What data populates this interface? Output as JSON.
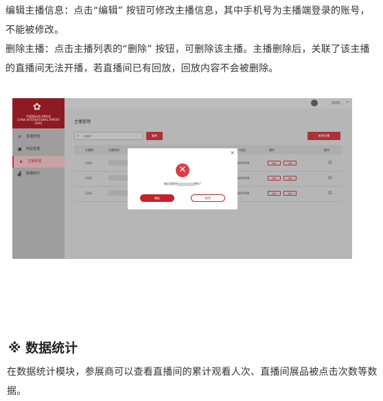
{
  "paragraphs": {
    "edit": "编辑主播信息：点击“编辑” 按钮可修改主播信息，其中手机号为主播端登录的账号，不能被修改。",
    "delete": "删除主播：点击主播列表的“删除” 按钮，可删除该主播。主播删除后，关联了该主播的直播间无法开播，若直播间已有回放，回放内容不会被删除。",
    "stats": "在数据统计模块，参展商可以查看直播间的累计观看人次、直播间展品被点击次数等数据。"
  },
  "section_title": "※ 数据统计",
  "screenshot": {
    "logo_text": "中国国际进口博览会",
    "logo_subtext": "CHINA INTERNATIONAL IMPORT EXPO",
    "sidebar": [
      {
        "label": "直播管理",
        "icon": "gear-icon",
        "active": false
      },
      {
        "label": "商品管理",
        "icon": "box-icon",
        "active": false
      },
      {
        "label": "主播管理",
        "icon": "person-icon",
        "active": true
      },
      {
        "label": "数据统计",
        "icon": "bar-chart-icon",
        "active": false
      }
    ],
    "user_name": "测试账...",
    "page_title": "主播管理",
    "search_placeholder": "主播ID",
    "search_button": "查询",
    "add_button": "新增主播",
    "columns": [
      "主播ID",
      "主播名称",
      "联系人电话",
      "操作",
      "操作"
    ],
    "rows": [
      {
        "id": "2345",
        "phone": "1324487898",
        "edit": "编辑",
        "delete": "删除"
      },
      {
        "id": "2345",
        "phone": "1324487898",
        "edit": "编辑",
        "delete": "删除"
      },
      {
        "id": "2345",
        "phone": "1324487898",
        "edit": "编辑",
        "delete": "删除"
      }
    ],
    "modal": {
      "message_prefix": "确定要删除",
      "message_suffix": "播吗?",
      "confirm": "确定",
      "cancel": "取消"
    }
  },
  "colors": {
    "brand_red": "#a9323b",
    "alert_red": "#e03b45"
  }
}
